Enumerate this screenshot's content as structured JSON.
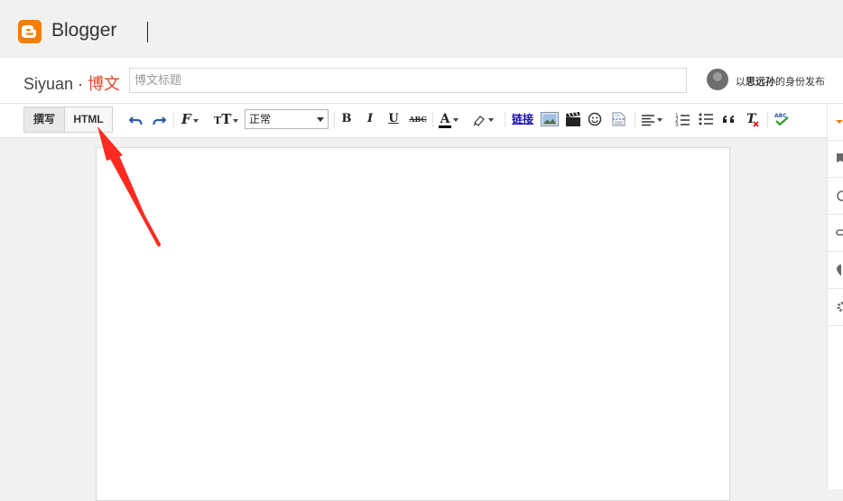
{
  "app": {
    "logo_text": "Blogger",
    "brand_color": "#f57d00",
    "logo_icon": "blogger-b-icon"
  },
  "titlerow": {
    "blog_name": "Siyuan",
    "separator": " · ",
    "section": "博文",
    "section_color": "#dd4b26",
    "title_placeholder": "博文标题",
    "title_value": "",
    "publish_prefix": "以",
    "publish_name": "思远孙",
    "publish_suffix": "的身份发布"
  },
  "toolbar": {
    "compose_label": "撰写",
    "html_label": "HTML",
    "format_value": "正常",
    "bold_label": "B",
    "italic_label": "I",
    "underline_label": "U",
    "strike_label": "ABC",
    "link_label": "链接",
    "icons": [
      "undo-icon",
      "redo-icon",
      "font-family-icon",
      "font-size-icon",
      "bold-icon",
      "italic-icon",
      "underline-icon",
      "strikethrough-icon",
      "text-color-icon",
      "highlight-icon",
      "link-icon",
      "image-icon",
      "video-icon",
      "emoji-icon",
      "jump-break-icon",
      "align-icon",
      "numbered-list-icon",
      "bullet-list-icon",
      "quote-icon",
      "remove-format-icon",
      "spellcheck-icon"
    ]
  },
  "sidebar": {
    "items": [
      "settings-caret-icon",
      "labels-icon",
      "schedule-icon",
      "permalink-icon",
      "location-icon",
      "options-icon"
    ]
  },
  "annotation": {
    "color": "#ff2a1f"
  }
}
